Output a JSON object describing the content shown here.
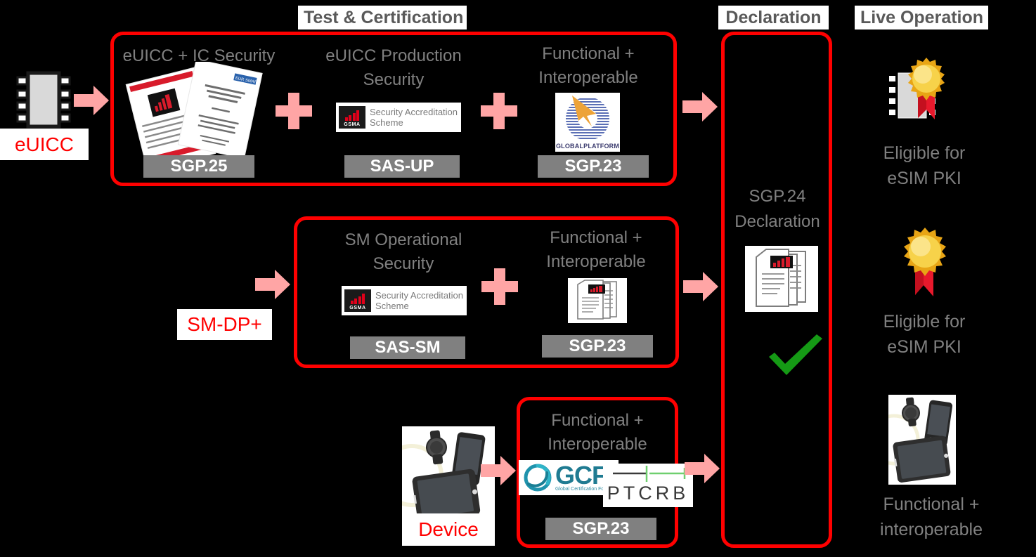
{
  "phases": [
    {
      "id": "test-certification",
      "label": "Test & Certification"
    },
    {
      "id": "declaration",
      "label": "Declaration"
    },
    {
      "id": "live-operation",
      "label": "Live Operation"
    }
  ],
  "entities": [
    {
      "id": "euicc",
      "label": "eUICC"
    },
    {
      "id": "sm-dp-plus",
      "label": "SM-DP+"
    },
    {
      "id": "device",
      "label": "Device"
    }
  ],
  "rows": {
    "euicc": {
      "items": [
        {
          "caption": "eUICC + IC Security",
          "spec": "SGP.25",
          "logo": "documents-icon"
        },
        {
          "caption": "eUICC Production\nSecurity",
          "spec": "SAS-UP",
          "logo": "gsma-sas-logo"
        },
        {
          "caption": "Functional +\nInteroperable",
          "spec": "SGP.23",
          "logo": "globalplatform-logo"
        }
      ]
    },
    "smdp": {
      "items": [
        {
          "caption": "SM Operational\nSecurity",
          "spec": "SAS-SM",
          "logo": "gsma-sas-logo"
        },
        {
          "caption": "Functional +\nInteroperable",
          "spec": "SGP.23",
          "logo": "document-stack-icon"
        }
      ]
    },
    "device": {
      "items": [
        {
          "caption": "Functional +\nInteroperable",
          "spec": "SGP.23",
          "logo": "gcf-ptcrb-logo"
        }
      ]
    }
  },
  "declaration": {
    "title": "SGP.24\nDeclaration",
    "doc_icon": "document-stack-icon",
    "check_icon": "green-check-icon"
  },
  "live_operation": {
    "items": [
      {
        "icon": "award-euicc-icon",
        "label": "Eligible for\neSIM  PKI"
      },
      {
        "icon": "award-ribbon-icon",
        "label": "Eligible for\neSIM PKI"
      },
      {
        "icon": "devices-icon",
        "label": "Functional +\ninteroperable"
      }
    ]
  },
  "logos": {
    "gsma_sas": {
      "brand": "GSMA",
      "text": "Security Accreditation\nScheme"
    },
    "globalplatform": {
      "name": "GLOBALPLATFORM"
    },
    "gcf": {
      "name": "GCF",
      "tagline": "Global Certification Forum"
    },
    "ptcrb": {
      "name": "PTCRB"
    }
  },
  "colors": {
    "background": "#000000",
    "box_border": "#ff0000",
    "entity_text": "#ff0000",
    "caption_text": "#808080",
    "chip_bg": "#808080",
    "chip_text": "#ffffff",
    "arrow": "#ffa5a5",
    "plus": "#ffa5a5",
    "phase_label_bg": "#ffffff",
    "phase_label_text": "#595959",
    "check": "#159a15"
  }
}
